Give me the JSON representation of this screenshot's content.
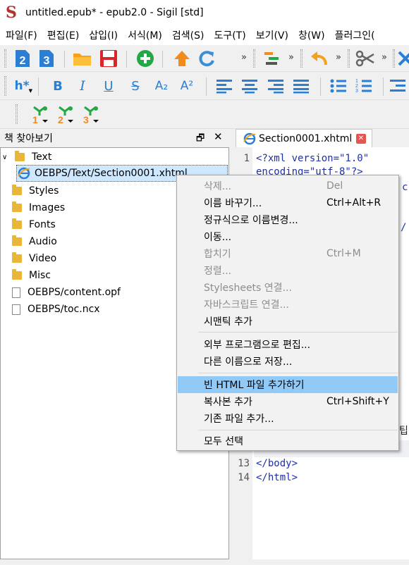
{
  "window": {
    "title": "untitled.epub* - epub2.0 - Sigil [std]",
    "logo_letter": "S"
  },
  "menubar": [
    "파일(F)",
    "편집(E)",
    "삽입(I)",
    "서식(M)",
    "검색(S)",
    "도구(T)",
    "보기(V)",
    "창(W)",
    "플러그인("
  ],
  "toolbar_format": {
    "heading_label": "h*",
    "bold": "B",
    "italic": "I",
    "underline": "U",
    "strike": "S",
    "sub": "A₂",
    "sup": "A²"
  },
  "book_browser": {
    "title": "책 찾아보기",
    "tree": [
      {
        "label": "Text",
        "type": "folder",
        "level": 0,
        "expanded": true
      },
      {
        "label": "OEBPS/Text/Section0001.xhtml",
        "type": "xhtml",
        "level": 1,
        "selected": true
      },
      {
        "label": "Styles",
        "type": "folder",
        "level": 0
      },
      {
        "label": "Images",
        "type": "folder",
        "level": 0
      },
      {
        "label": "Fonts",
        "type": "folder",
        "level": 0
      },
      {
        "label": "Audio",
        "type": "folder",
        "level": 0
      },
      {
        "label": "Video",
        "type": "folder",
        "level": 0
      },
      {
        "label": "Misc",
        "type": "folder",
        "level": 0
      },
      {
        "label": "OEBPS/content.opf",
        "type": "file",
        "level": 0
      },
      {
        "label": "OEBPS/toc.ncx",
        "type": "file",
        "level": 0
      }
    ]
  },
  "editor": {
    "tab_label": "Section0001.xhtml",
    "line_numbers": [
      "1",
      "13",
      "14"
    ],
    "code": {
      "l1a": "<?xml version=\"1.0\"",
      "l1b": "encoding=\"utf-8\"?>",
      "l13": "</body>",
      "l14": "</html>"
    },
    "partial_glyphs": {
      "c1": "c",
      "c2": "/",
      "c3": "팁"
    }
  },
  "context_menu": {
    "items": [
      {
        "label": "삭제...",
        "shortcut": "Del",
        "disabled": true
      },
      {
        "label": "이름 바꾸기...",
        "shortcut": "Ctrl+Alt+R"
      },
      {
        "label": "정규식으로 이름변경...",
        "shortcut": ""
      },
      {
        "label": "이동...",
        "shortcut": ""
      },
      {
        "label": "합치기",
        "shortcut": "Ctrl+M",
        "disabled": true
      },
      {
        "label": "정렬...",
        "shortcut": "",
        "disabled": true
      },
      {
        "label": "Stylesheets 연결...",
        "shortcut": "",
        "disabled": true
      },
      {
        "label": "자바스크립트 연결...",
        "shortcut": "",
        "disabled": true
      },
      {
        "label": "시맨틱 추가",
        "shortcut": ""
      },
      {
        "label": "외부 프로그램으로 편집...",
        "shortcut": ""
      },
      {
        "label": "다른 이름으로 저장...",
        "shortcut": ""
      },
      {
        "label": "빈 HTML 파일 추가하기",
        "shortcut": "",
        "highlighted": true
      },
      {
        "label": "복사본 추가",
        "shortcut": "Ctrl+Shift+Y"
      },
      {
        "label": "기존 파일 추가...",
        "shortcut": ""
      },
      {
        "label": "모두 선택",
        "shortcut": ""
      }
    ]
  },
  "colors": {
    "accent_blue": "#2a7fd4",
    "highlight": "#91c9f7",
    "save_red": "#d9262b",
    "add_green": "#22a845",
    "up_orange": "#f08c1e"
  }
}
